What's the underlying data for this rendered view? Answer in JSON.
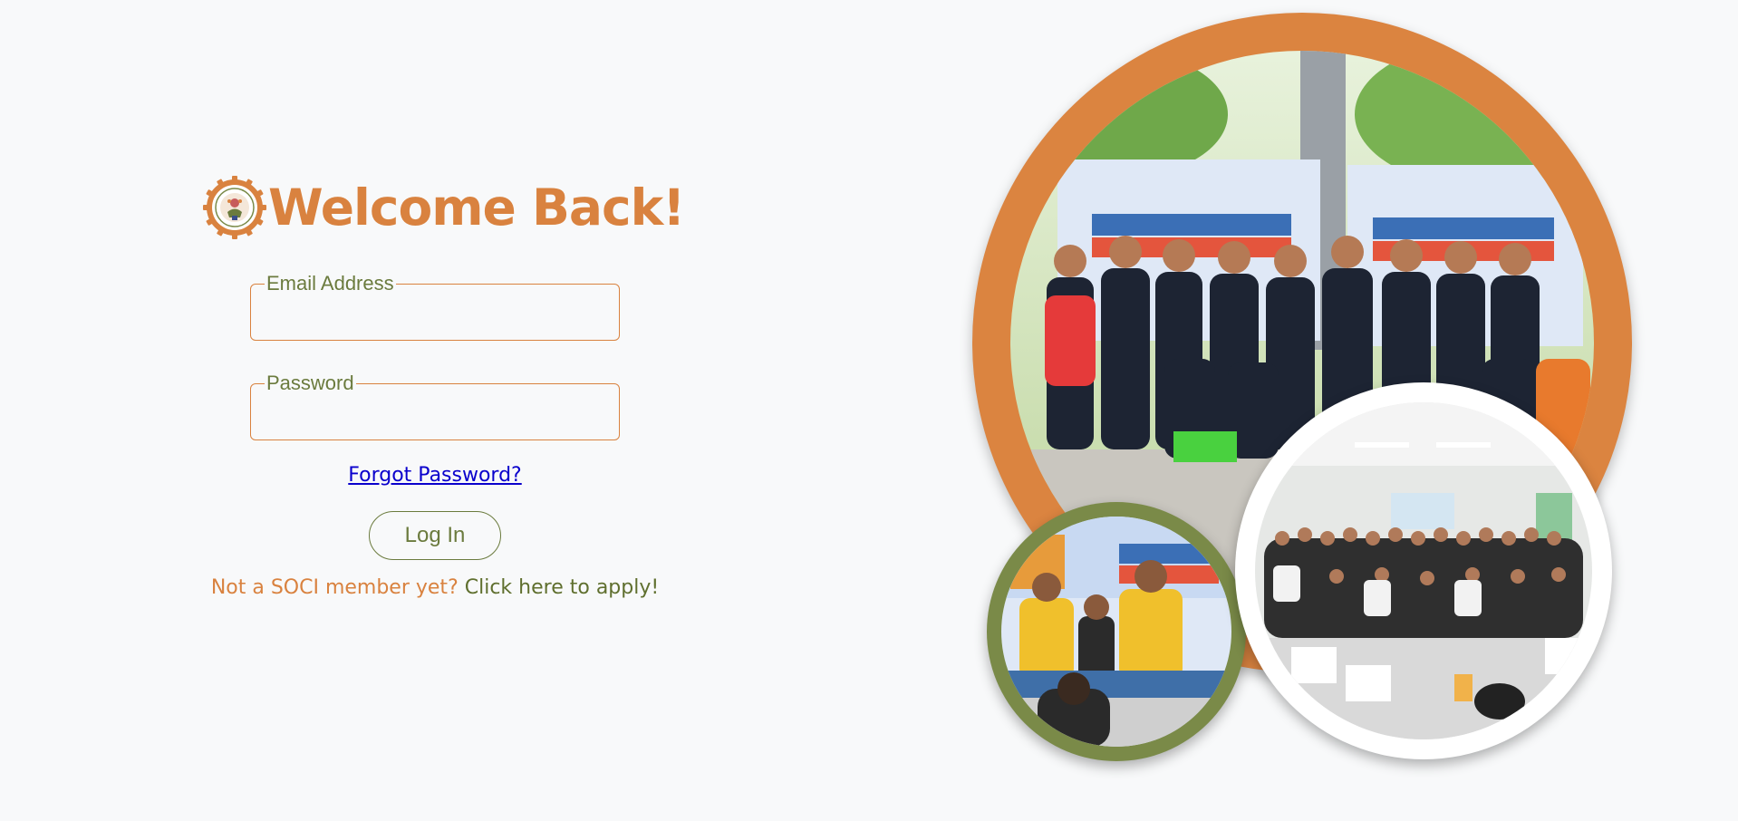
{
  "login": {
    "title": "Welcome Back!",
    "email_label": "Email Address",
    "email_value": "",
    "password_label": "Password",
    "password_value": "",
    "forgot_password": "Forgot Password?",
    "login_button": "Log In",
    "apply_prompt": "Not a SOCI member yet?",
    "apply_link": "Click here to apply!"
  },
  "logo": {
    "icon": "organization-seal-icon"
  },
  "colors": {
    "background": "#f8f9fa",
    "accent_orange": "#d9823f",
    "accent_olive": "#6b7b3e",
    "link_blue": "#0a00cc"
  },
  "collage": {
    "photos": [
      {
        "name": "group-photo-main",
        "frame_color": "#db8440"
      },
      {
        "name": "feeding-program-photo",
        "frame_color": "#7a8a48"
      },
      {
        "name": "assembly-photo",
        "frame_color": "#ffffff"
      }
    ]
  }
}
